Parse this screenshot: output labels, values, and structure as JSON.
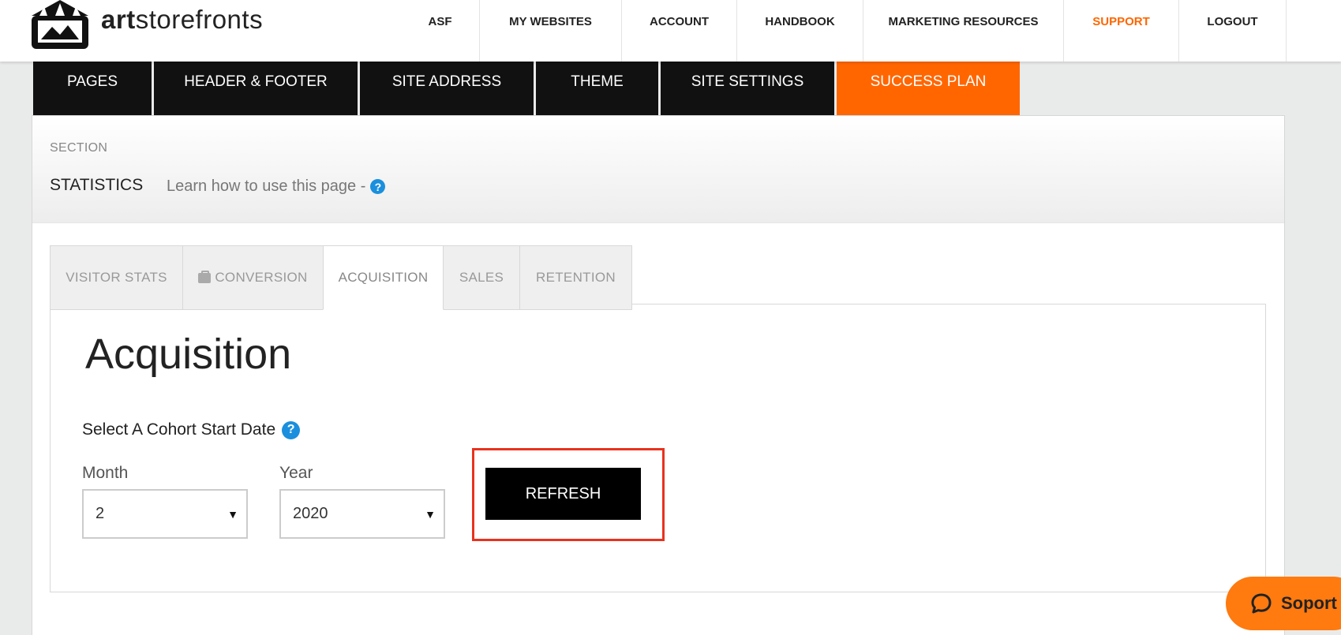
{
  "header": {
    "brand_bold": "art",
    "brand_rest": "storefronts",
    "nav": [
      "ASF",
      "MY WEBSITES",
      "ACCOUNT",
      "HANDBOOK",
      "MARKETING RESOURCES",
      "SUPPORT",
      "LOGOUT"
    ],
    "accent_color": "#ff6600"
  },
  "section_tabs": [
    "PAGES",
    "HEADER & FOOTER",
    "SITE ADDRESS",
    "THEME",
    "SITE SETTINGS",
    "SUCCESS PLAN"
  ],
  "section_tabs_active": "SUCCESS PLAN",
  "panel": {
    "section_label": "SECTION",
    "section_title": "STATISTICS",
    "learn_text": "Learn how to use this page -",
    "help_icon": "question-circle-icon"
  },
  "stats_tabs": [
    "VISITOR STATS",
    "CONVERSION",
    "ACQUISITION",
    "SALES",
    "RETENTION"
  ],
  "stats_tabs_active": "ACQUISITION",
  "acquisition": {
    "title": "Acquisition",
    "cohort_label": "Select A Cohort Start Date",
    "month_label": "Month",
    "month_value": "2",
    "year_label": "Year",
    "year_value": "2020",
    "refresh_label": "REFRESH"
  },
  "chat": {
    "label": "Soport",
    "icon": "chat-bubble-icon"
  }
}
